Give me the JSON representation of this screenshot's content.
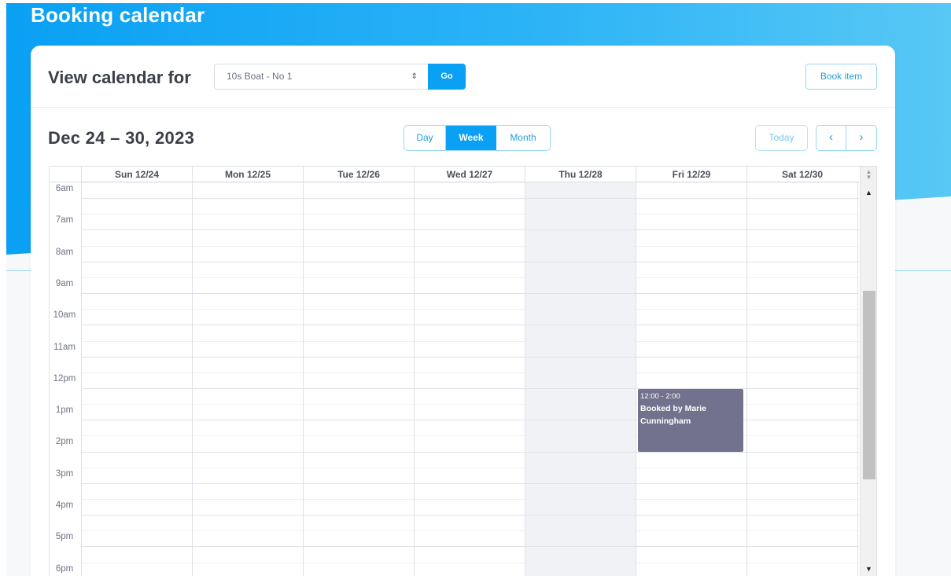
{
  "page": {
    "title": "Booking calendar"
  },
  "toolbar": {
    "view_label": "View calendar for",
    "selected_item": "10s Boat - No 1",
    "go_label": "Go",
    "book_label": "Book item"
  },
  "calendar": {
    "date_range": "Dec 24 – 30, 2023",
    "views": {
      "day": "Day",
      "week": "Week",
      "month": "Month",
      "active": "Week"
    },
    "today_label": "Today",
    "prev_icon": "chevron-left-icon",
    "next_icon": "chevron-right-icon",
    "days": [
      "Sun 12/24",
      "Mon 12/25",
      "Tue 12/26",
      "Wed 12/27",
      "Thu 12/28",
      "Fri 12/29",
      "Sat 12/30"
    ],
    "today_day": "Thu 12/28",
    "times": [
      "6am",
      "7am",
      "8am",
      "9am",
      "10am",
      "11am",
      "12pm",
      "1pm",
      "2pm",
      "3pm",
      "4pm",
      "5pm",
      "6pm"
    ],
    "events": [
      {
        "day": "Fri 12/29",
        "time": "12:00 - 2:00",
        "title": "Booked by Marie Cunningham",
        "color": "#73728e"
      }
    ]
  },
  "colors": {
    "accent": "#0aa0f4",
    "today_column": "#f1f2f6",
    "event": "#73728e"
  }
}
